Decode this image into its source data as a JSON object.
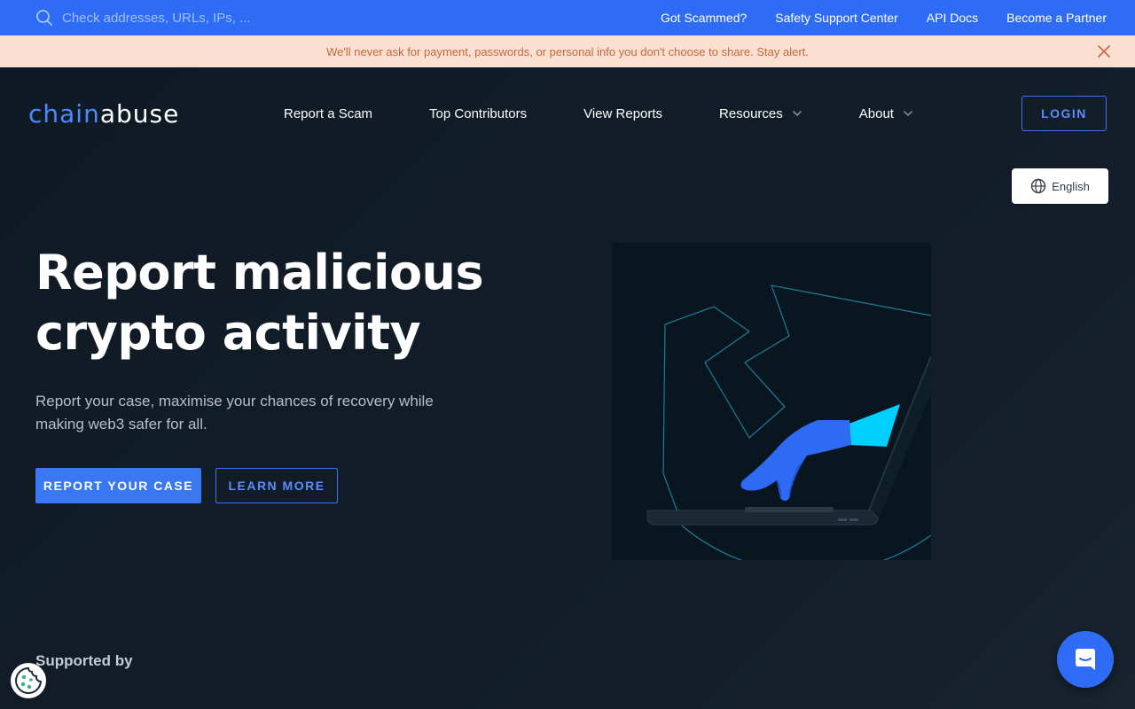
{
  "topbar": {
    "search": {
      "placeholder": "Check addresses, URLs, IPs, ..."
    },
    "links": [
      {
        "label": "Got Scammed?"
      },
      {
        "label": "Safety Support Center"
      },
      {
        "label": "API Docs"
      },
      {
        "label": "Become a Partner"
      }
    ]
  },
  "alert": {
    "message": "We'll never ask for payment, passwords, or personal info you don't choose to share. Stay alert."
  },
  "nav": {
    "logo_part1": "chain",
    "logo_part2": "abuse",
    "items": [
      {
        "label": "Report a Scam"
      },
      {
        "label": "Top Contributors"
      },
      {
        "label": "View Reports"
      },
      {
        "label": "Resources"
      },
      {
        "label": "About"
      }
    ],
    "login_label": "LOGIN"
  },
  "language": {
    "label": "English"
  },
  "hero": {
    "title_line1": "Report malicious",
    "title_line2": "crypto activity",
    "subtitle_line1": "Report your case, maximise your chances of recovery while",
    "subtitle_line2": "making web3 safer for all.",
    "primary_cta": "REPORT YOUR CASE",
    "secondary_cta": "LEARN MORE"
  },
  "supported_by": "Supported by",
  "colors": {
    "brand_blue": "#2e6cf6",
    "alert_bg": "#fbe0d2",
    "alert_text": "#c4683d",
    "page_bg": "#0f1a24",
    "accent_cyan": "#00d1ff"
  },
  "icons": {
    "search": "search-icon",
    "close": "close-icon",
    "chevron": "chevron-down-icon",
    "globe": "globe-icon",
    "cookie": "cookie-icon",
    "chat": "chat-icon"
  }
}
